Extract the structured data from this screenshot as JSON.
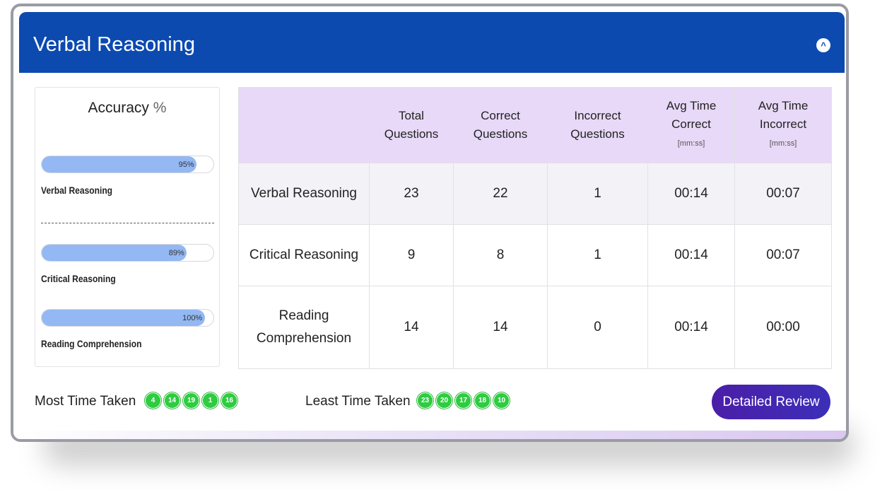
{
  "header": {
    "title": "Verbal Reasoning",
    "collapse_icon": "chevron-up-icon",
    "collapse_glyph": "^"
  },
  "accuracy": {
    "title": "Accuracy",
    "title_pct": "%",
    "items": [
      {
        "label": "Verbal Reasoning",
        "value_text": "95%",
        "value": 95
      },
      {
        "label": "Critical Reasoning",
        "value_text": "89%",
        "value": 89
      },
      {
        "label": "Reading Comprehension",
        "value_text": "100%",
        "value": 100
      }
    ]
  },
  "table": {
    "headers": [
      {
        "line1": "",
        "line2": "",
        "unit": ""
      },
      {
        "line1": "Total",
        "line2": "Questions",
        "unit": ""
      },
      {
        "line1": "Correct",
        "line2": "Questions",
        "unit": ""
      },
      {
        "line1": "Incorrect",
        "line2": "Questions",
        "unit": ""
      },
      {
        "line1": "Avg Time",
        "line2": "Correct",
        "unit": "[mm:ss]"
      },
      {
        "line1": "Avg Time",
        "line2": "Incorrect",
        "unit": "[mm:ss]"
      }
    ],
    "rows": [
      {
        "name_line1": "Verbal Reasoning",
        "name_line2": "",
        "total": "23",
        "correct": "22",
        "incorrect": "1",
        "avg_correct": "00:14",
        "avg_incorrect": "00:07"
      },
      {
        "name_line1": "Critical Reasoning",
        "name_line2": "",
        "total": "9",
        "correct": "8",
        "incorrect": "1",
        "avg_correct": "00:14",
        "avg_incorrect": "00:07"
      },
      {
        "name_line1": "Reading",
        "name_line2": "Comprehension",
        "total": "14",
        "correct": "14",
        "incorrect": "0",
        "avg_correct": "00:14",
        "avg_incorrect": "00:00"
      }
    ]
  },
  "footer": {
    "most_time_label": "Most Time Taken",
    "most_time_questions": [
      "4",
      "14",
      "19",
      "1",
      "16"
    ],
    "least_time_label": "Least Time Taken",
    "least_time_questions": [
      "23",
      "20",
      "17",
      "18",
      "10"
    ],
    "review_button_label": "Detailed Review"
  },
  "colors": {
    "header_bg": "#0c4ab0",
    "bar_fill": "#93b8f3",
    "table_header_bg": "#e7d9f7",
    "chip_green": "#2ecc40",
    "button_purple": "#4b1ea8"
  }
}
